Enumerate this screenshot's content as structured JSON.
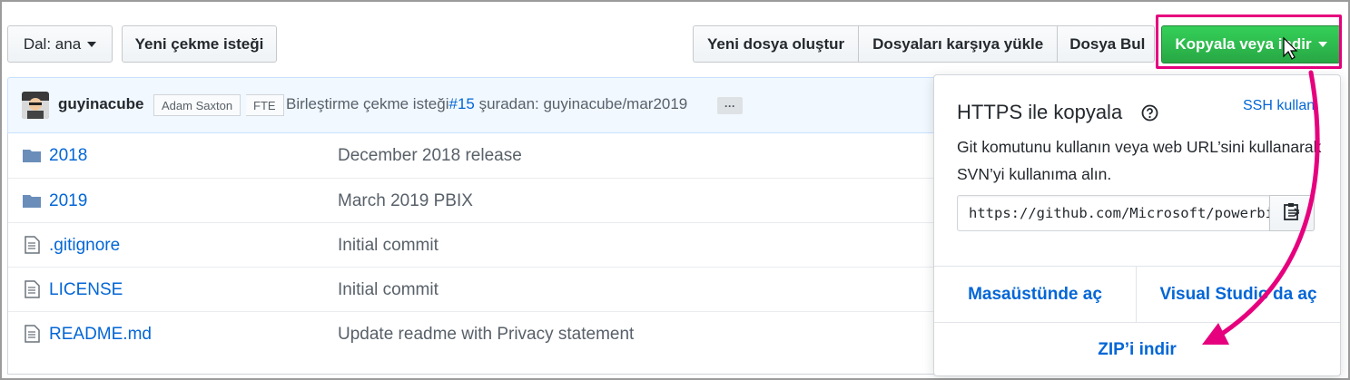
{
  "toolbar": {
    "branch_label": "Dal: ana",
    "new_pr_label": "Yeni çekme isteği",
    "create_file_label": "Yeni dosya oluştur",
    "upload_label": "Dosyaları karşıya yükle",
    "find_file_label": "Dosya Bul",
    "clone_label": "Kopyala veya indir"
  },
  "commit": {
    "author": "guyinacube",
    "coauthor_tag": "Adam Saxton",
    "fte_tag": "FTE",
    "message_prefix": "Birleştirme çekme isteği",
    "pr_link": "#15",
    "message_suffix": " şuradan: guyinacube/mar2019",
    "more_label": "···"
  },
  "files": [
    {
      "type": "folder",
      "name": "2018",
      "message": "December 2018 release"
    },
    {
      "type": "folder",
      "name": "2019",
      "message": "March 2019 PBIX"
    },
    {
      "type": "file",
      "name": ".gitignore",
      "message": "Initial commit"
    },
    {
      "type": "file",
      "name": "LICENSE",
      "message": "Initial commit"
    },
    {
      "type": "file",
      "name": "README.md",
      "message": "Update readme with Privacy statement"
    }
  ],
  "clone_dropdown": {
    "title": "HTTPS ile kopyala",
    "ssh_link": "SSH kullan",
    "description": "Git komutunu kullanın veya web URL’sini kullanarak SVN’yi kullanıma alın.",
    "url": "https://github.com/Microsoft/powerbi-desktop-samples.git",
    "open_desktop": "Masaüstünde aç",
    "open_vs": "Visual Studio'da aç",
    "download_zip": "ZIP’i indir"
  },
  "colors": {
    "accent_link": "#0366d6",
    "primary_green": "#28a745",
    "annotation_magenta": "#e6007e"
  }
}
